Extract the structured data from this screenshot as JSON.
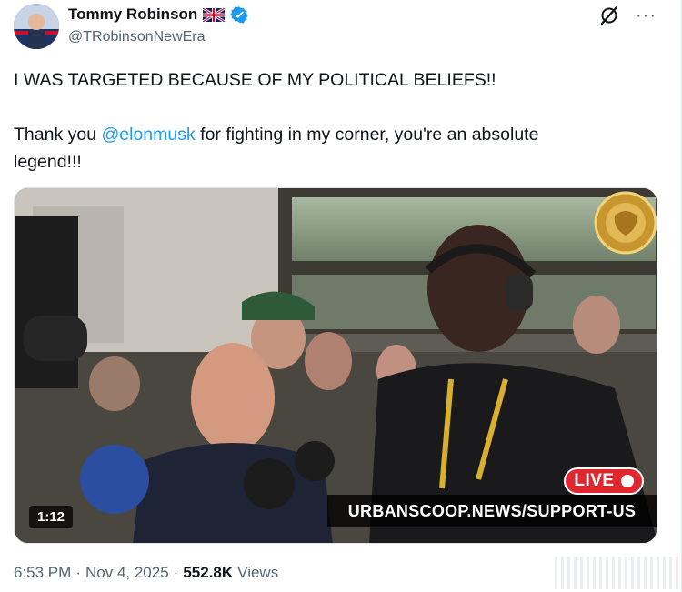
{
  "author": {
    "name": "Tommy Robinson",
    "handle": "@TRobinsonNewEra",
    "flag_icon": "uk-flag-icon",
    "verified_icon": "verified-badge-icon"
  },
  "actions": {
    "grok_icon": "grok-icon",
    "more_label": "···"
  },
  "tweet": {
    "line1": "I WAS TARGETED BECAUSE OF MY POLITICAL BELIEFS!!",
    "line2_prefix": "Thank you ",
    "mention": "@elonmusk",
    "line2_suffix": " for fighting in my corner, you're an absolute",
    "line3": "legend!!!"
  },
  "media": {
    "duration": "1:12",
    "live_label": "LIVE",
    "banner_text": "URBANSCOOP.NEWS/SUPPORT-US"
  },
  "meta": {
    "time": "6:53 PM",
    "separator": "·",
    "date": "Nov 4, 2025",
    "views_count": "552.8K",
    "views_label": "Views"
  },
  "colors": {
    "link": "#1d9bf0",
    "secondary_text": "#536471",
    "live_red": "#e0262f"
  }
}
